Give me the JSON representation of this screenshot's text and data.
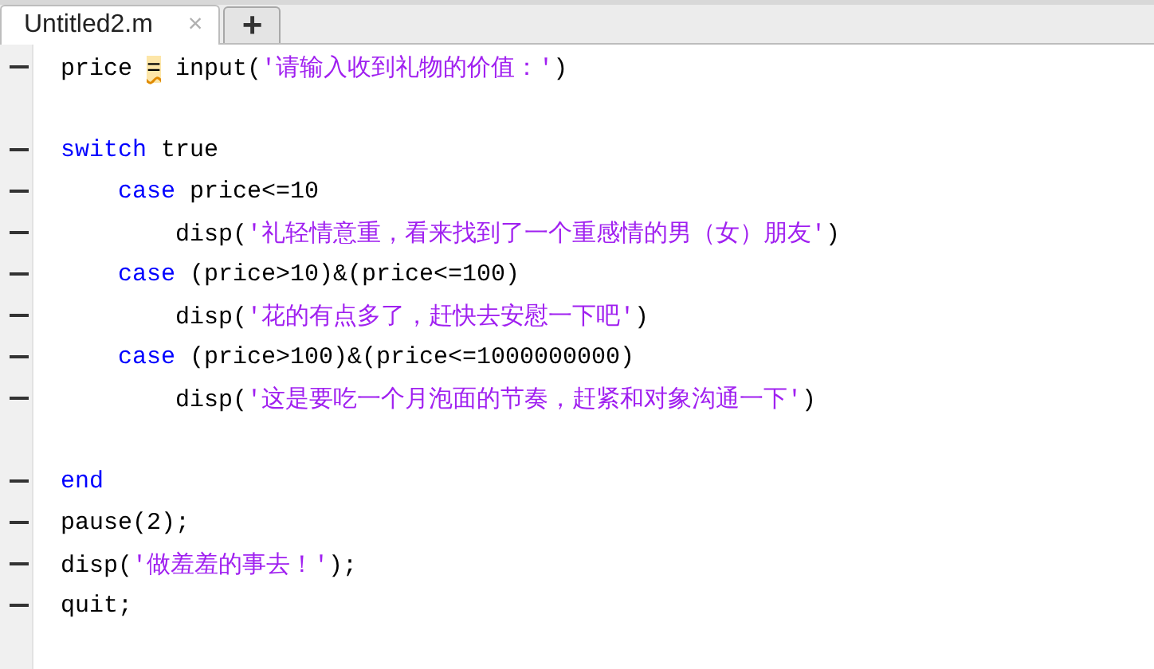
{
  "tabs": [
    {
      "label": "Untitled2.m",
      "selected": true,
      "close": "×"
    }
  ],
  "new_tab_button": "+",
  "code": [
    {
      "executable": true,
      "tokens": [
        {
          "kind": "plain",
          "text": "price "
        },
        {
          "kind": "warning",
          "text": "="
        },
        {
          "kind": "plain",
          "text": " input("
        },
        {
          "kind": "string",
          "text": "'请输入收到礼物的价值：'"
        },
        {
          "kind": "plain",
          "text": ")"
        }
      ]
    },
    {
      "executable": false
    },
    {
      "executable": true,
      "tokens": [
        {
          "kind": "keyword",
          "text": "switch"
        },
        {
          "kind": "plain",
          "text": " true"
        }
      ],
      "children": [
        {
          "executable": true,
          "tokens": [
            {
              "kind": "keyword",
              "text": "case"
            },
            {
              "kind": "plain",
              "text": " price<=10"
            }
          ],
          "children": [
            {
              "executable": true,
              "tokens": [
                {
                  "kind": "plain",
                  "text": "disp("
                },
                {
                  "kind": "string",
                  "text": "'礼轻情意重，看来找到了一个重感情的男（女）朋友'"
                },
                {
                  "kind": "plain",
                  "text": ")"
                }
              ]
            }
          ]
        },
        {
          "executable": true,
          "tokens": [
            {
              "kind": "keyword",
              "text": "case"
            },
            {
              "kind": "plain",
              "text": " (price>10)&(price<=100)"
            }
          ],
          "children": [
            {
              "executable": true,
              "tokens": [
                {
                  "kind": "plain",
                  "text": "disp("
                },
                {
                  "kind": "string",
                  "text": "'花的有点多了，赶快去安慰一下吧'"
                },
                {
                  "kind": "plain",
                  "text": ")"
                }
              ]
            }
          ]
        },
        {
          "executable": true,
          "tokens": [
            {
              "kind": "keyword",
              "text": "case"
            },
            {
              "kind": "plain",
              "text": " (price>100)&(price<=1000000000)"
            }
          ],
          "children": [
            {
              "executable": true,
              "tokens": [
                {
                  "kind": "plain",
                  "text": "disp("
                },
                {
                  "kind": "string",
                  "text": "'这是要吃一个月泡面的节奏，赶紧和对象沟通一下'"
                },
                {
                  "kind": "plain",
                  "text": ")"
                }
              ]
            }
          ]
        }
      ]
    },
    {
      "executable": false
    },
    {
      "executable": true,
      "tokens": [
        {
          "kind": "keyword",
          "text": "end"
        }
      ]
    },
    {
      "executable": true,
      "tokens": [
        {
          "kind": "plain",
          "text": "pause(2);"
        }
      ]
    },
    {
      "executable": true,
      "tokens": [
        {
          "kind": "plain",
          "text": "disp("
        },
        {
          "kind": "string",
          "text": "'做羞羞的事去！'"
        },
        {
          "kind": "plain",
          "text": ");"
        }
      ]
    },
    {
      "executable": true,
      "tokens": [
        {
          "kind": "plain",
          "text": "quit;"
        }
      ]
    }
  ]
}
